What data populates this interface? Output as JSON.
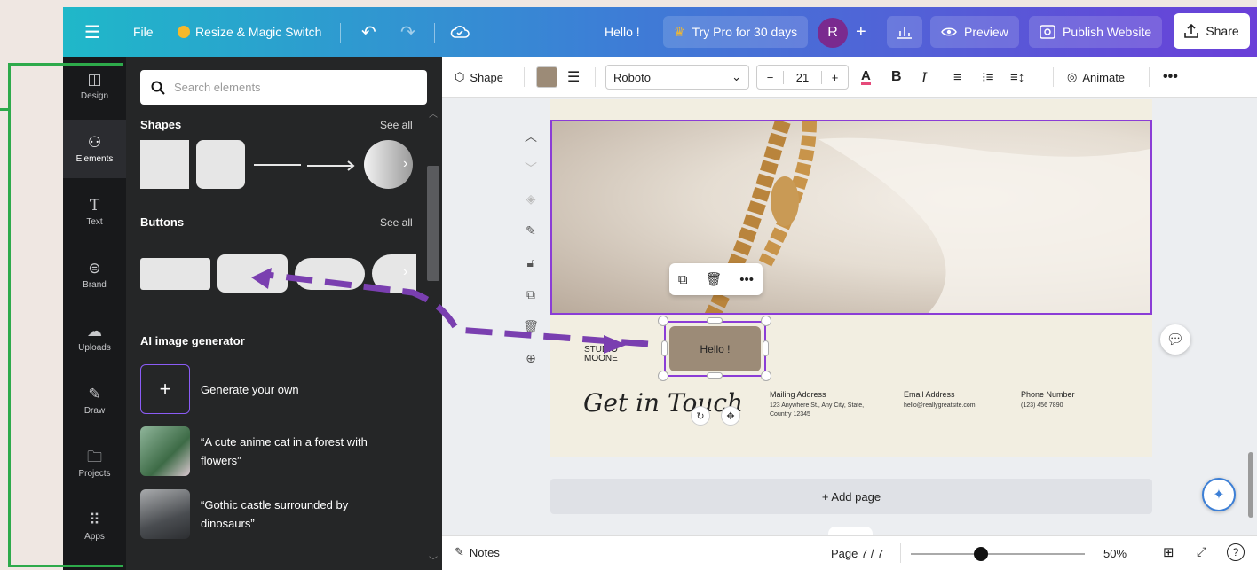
{
  "topbar": {
    "file_label": "File",
    "resize_label": "Resize & Magic Switch",
    "doc_title": "Hello !",
    "try_pro_label": "Try Pro for 30 days",
    "avatar_initial": "R",
    "preview_label": "Preview",
    "publish_label": "Publish Website",
    "share_label": "Share"
  },
  "rail": {
    "items": [
      {
        "label": "Design",
        "icon": "layout-icon"
      },
      {
        "label": "Elements",
        "icon": "shapes-icon"
      },
      {
        "label": "Text",
        "icon": "text-icon"
      },
      {
        "label": "Brand",
        "icon": "brand-icon"
      },
      {
        "label": "Uploads",
        "icon": "cloud-upload-icon"
      },
      {
        "label": "Draw",
        "icon": "draw-icon"
      },
      {
        "label": "Projects",
        "icon": "folder-icon"
      },
      {
        "label": "Apps",
        "icon": "grid-icon"
      }
    ]
  },
  "panel": {
    "search_placeholder": "Search elements",
    "shapes_title": "Shapes",
    "buttons_title": "Buttons",
    "see_all": "See all",
    "ai_title": "AI image generator",
    "generate_label": "Generate your own",
    "prompts": [
      "“A cute anime cat in a forest with flowers”",
      "“Gothic castle surrounded by dinosaurs”"
    ]
  },
  "toolbar": {
    "shape_label": "Shape",
    "fill_color": "#9c8b77",
    "font_name": "Roboto",
    "font_size": "21",
    "animate_label": "Animate"
  },
  "canvas": {
    "button_text": "Hello !",
    "studio_text": "STUDIO MOONE",
    "heading": "Get in Touch",
    "mailing_label": "Mailing Address",
    "mailing_value": "123 Anywhere St., Any City, State, Country 12345",
    "email_label": "Email Address",
    "email_value": "hello@reallygreatsite.com",
    "phone_label": "Phone Number",
    "phone_value": "(123) 456 7890",
    "add_page": "+ Add page"
  },
  "bottombar": {
    "notes_label": "Notes",
    "page_indicator": "Page 7 / 7",
    "zoom_level": "50%"
  },
  "colors": {
    "topbar_start": "#1fb8c9",
    "topbar_end": "#6a3fd8",
    "selection": "#8b3dd6",
    "annotation_arrow": "#7a3fb0",
    "annotation_bracket": "#2eaa4b"
  }
}
